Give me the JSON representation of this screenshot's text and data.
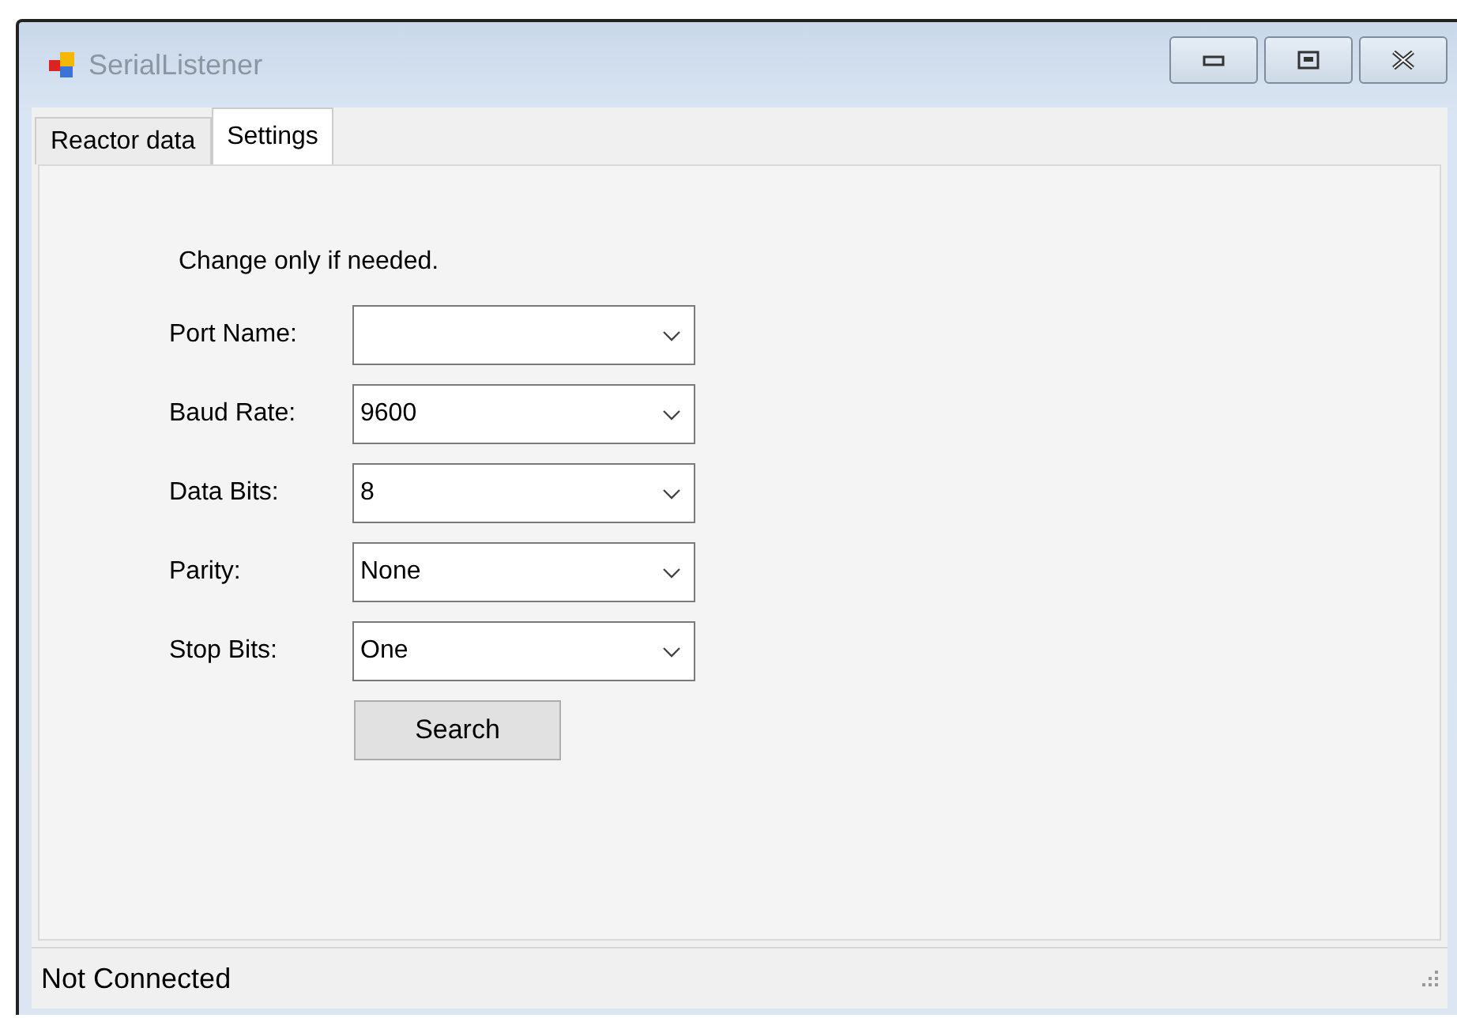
{
  "window": {
    "title": "SerialListener"
  },
  "tabs": [
    {
      "label": "Reactor data",
      "selected": false
    },
    {
      "label": "Settings",
      "selected": true
    }
  ],
  "settings": {
    "note": "Change only if needed.",
    "fields": [
      {
        "label": "Port Name:"
      },
      {
        "label": "Baud Rate:",
        "value": "9600"
      },
      {
        "label": "Data Bits:",
        "value": "8"
      },
      {
        "label": "Parity:",
        "value": "None"
      },
      {
        "label": "Stop Bits:",
        "value": "One"
      }
    ],
    "button": "Search"
  },
  "status_bar": "Not Connected"
}
